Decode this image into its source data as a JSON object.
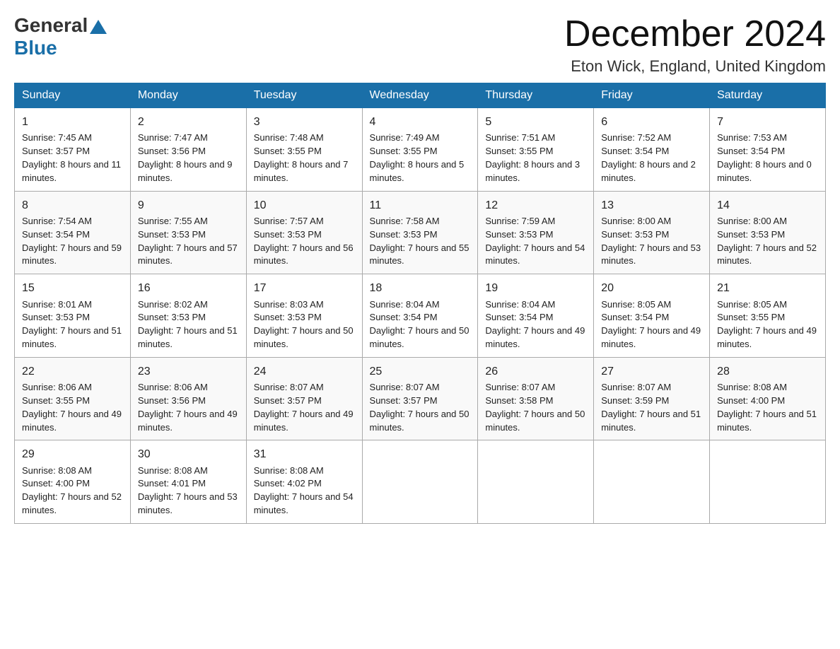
{
  "logo": {
    "general": "General",
    "blue": "Blue"
  },
  "title": "December 2024",
  "location": "Eton Wick, England, United Kingdom",
  "days_header": [
    "Sunday",
    "Monday",
    "Tuesday",
    "Wednesday",
    "Thursday",
    "Friday",
    "Saturday"
  ],
  "weeks": [
    [
      {
        "day": "1",
        "sunrise": "7:45 AM",
        "sunset": "3:57 PM",
        "daylight": "8 hours and 11 minutes."
      },
      {
        "day": "2",
        "sunrise": "7:47 AM",
        "sunset": "3:56 PM",
        "daylight": "8 hours and 9 minutes."
      },
      {
        "day": "3",
        "sunrise": "7:48 AM",
        "sunset": "3:55 PM",
        "daylight": "8 hours and 7 minutes."
      },
      {
        "day": "4",
        "sunrise": "7:49 AM",
        "sunset": "3:55 PM",
        "daylight": "8 hours and 5 minutes."
      },
      {
        "day": "5",
        "sunrise": "7:51 AM",
        "sunset": "3:55 PM",
        "daylight": "8 hours and 3 minutes."
      },
      {
        "day": "6",
        "sunrise": "7:52 AM",
        "sunset": "3:54 PM",
        "daylight": "8 hours and 2 minutes."
      },
      {
        "day": "7",
        "sunrise": "7:53 AM",
        "sunset": "3:54 PM",
        "daylight": "8 hours and 0 minutes."
      }
    ],
    [
      {
        "day": "8",
        "sunrise": "7:54 AM",
        "sunset": "3:54 PM",
        "daylight": "7 hours and 59 minutes."
      },
      {
        "day": "9",
        "sunrise": "7:55 AM",
        "sunset": "3:53 PM",
        "daylight": "7 hours and 57 minutes."
      },
      {
        "day": "10",
        "sunrise": "7:57 AM",
        "sunset": "3:53 PM",
        "daylight": "7 hours and 56 minutes."
      },
      {
        "day": "11",
        "sunrise": "7:58 AM",
        "sunset": "3:53 PM",
        "daylight": "7 hours and 55 minutes."
      },
      {
        "day": "12",
        "sunrise": "7:59 AM",
        "sunset": "3:53 PM",
        "daylight": "7 hours and 54 minutes."
      },
      {
        "day": "13",
        "sunrise": "8:00 AM",
        "sunset": "3:53 PM",
        "daylight": "7 hours and 53 minutes."
      },
      {
        "day": "14",
        "sunrise": "8:00 AM",
        "sunset": "3:53 PM",
        "daylight": "7 hours and 52 minutes."
      }
    ],
    [
      {
        "day": "15",
        "sunrise": "8:01 AM",
        "sunset": "3:53 PM",
        "daylight": "7 hours and 51 minutes."
      },
      {
        "day": "16",
        "sunrise": "8:02 AM",
        "sunset": "3:53 PM",
        "daylight": "7 hours and 51 minutes."
      },
      {
        "day": "17",
        "sunrise": "8:03 AM",
        "sunset": "3:53 PM",
        "daylight": "7 hours and 50 minutes."
      },
      {
        "day": "18",
        "sunrise": "8:04 AM",
        "sunset": "3:54 PM",
        "daylight": "7 hours and 50 minutes."
      },
      {
        "day": "19",
        "sunrise": "8:04 AM",
        "sunset": "3:54 PM",
        "daylight": "7 hours and 49 minutes."
      },
      {
        "day": "20",
        "sunrise": "8:05 AM",
        "sunset": "3:54 PM",
        "daylight": "7 hours and 49 minutes."
      },
      {
        "day": "21",
        "sunrise": "8:05 AM",
        "sunset": "3:55 PM",
        "daylight": "7 hours and 49 minutes."
      }
    ],
    [
      {
        "day": "22",
        "sunrise": "8:06 AM",
        "sunset": "3:55 PM",
        "daylight": "7 hours and 49 minutes."
      },
      {
        "day": "23",
        "sunrise": "8:06 AM",
        "sunset": "3:56 PM",
        "daylight": "7 hours and 49 minutes."
      },
      {
        "day": "24",
        "sunrise": "8:07 AM",
        "sunset": "3:57 PM",
        "daylight": "7 hours and 49 minutes."
      },
      {
        "day": "25",
        "sunrise": "8:07 AM",
        "sunset": "3:57 PM",
        "daylight": "7 hours and 50 minutes."
      },
      {
        "day": "26",
        "sunrise": "8:07 AM",
        "sunset": "3:58 PM",
        "daylight": "7 hours and 50 minutes."
      },
      {
        "day": "27",
        "sunrise": "8:07 AM",
        "sunset": "3:59 PM",
        "daylight": "7 hours and 51 minutes."
      },
      {
        "day": "28",
        "sunrise": "8:08 AM",
        "sunset": "4:00 PM",
        "daylight": "7 hours and 51 minutes."
      }
    ],
    [
      {
        "day": "29",
        "sunrise": "8:08 AM",
        "sunset": "4:00 PM",
        "daylight": "7 hours and 52 minutes."
      },
      {
        "day": "30",
        "sunrise": "8:08 AM",
        "sunset": "4:01 PM",
        "daylight": "7 hours and 53 minutes."
      },
      {
        "day": "31",
        "sunrise": "8:08 AM",
        "sunset": "4:02 PM",
        "daylight": "7 hours and 54 minutes."
      },
      null,
      null,
      null,
      null
    ]
  ]
}
